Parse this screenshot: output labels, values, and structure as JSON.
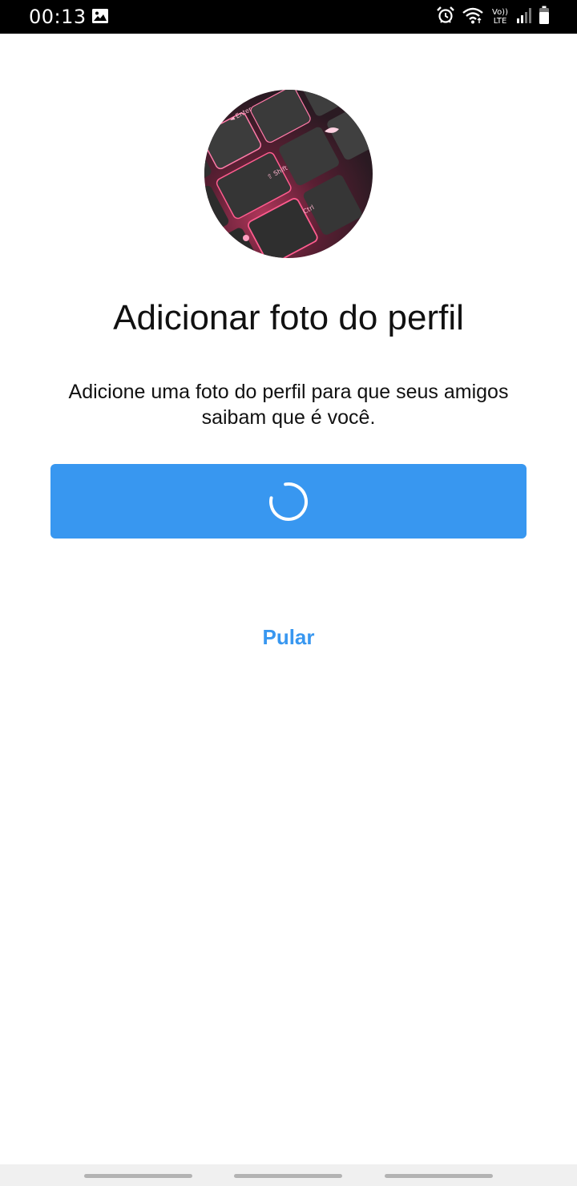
{
  "status_bar": {
    "time": "00:13",
    "volte_line1": "Vo))",
    "volte_line2": "LTE",
    "icons": [
      "gallery-icon",
      "alarm-icon",
      "wifi-icon",
      "volte-icon",
      "signal-icon",
      "battery-icon"
    ]
  },
  "profile": {
    "avatar_description_icon": "keyboard-photo-avatar",
    "title": "Adicionar foto do perfil",
    "description": "Adicione uma foto do perfil para que seus amigos saibam que é você."
  },
  "actions": {
    "primary_state": "loading",
    "skip_label": "Pular"
  },
  "colors": {
    "accent": "#3897f0",
    "status_bar": "#000000",
    "text": "#111111",
    "nav_bar": "#f0f0f0"
  }
}
